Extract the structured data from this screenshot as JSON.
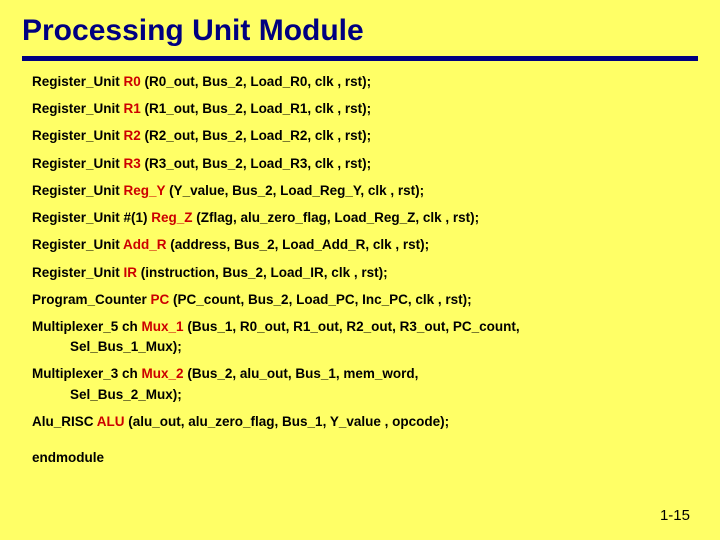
{
  "title": "Processing Unit Module",
  "lines": {
    "r0_a": "Register_Unit  ",
    "r0_b": "R0",
    "r0_c": " (R0_out, Bus_2, Load_R0, clk , rst);",
    "r1_a": "Register_Unit  ",
    "r1_b": "R1",
    "r1_c": " (R1_out, Bus_2, Load_R1, clk , rst);",
    "r2_a": "Register_Unit  ",
    "r2_b": "R2",
    "r2_c": " (R2_out, Bus_2, Load_R2, clk , rst);",
    "r3_a": "Register_Unit  ",
    "r3_b": "R3",
    "r3_c": " (R3_out, Bus_2, Load_R3, clk , rst);",
    "ry_a": "Register_Unit  ",
    "ry_b": "Reg_Y",
    "ry_c": " (Y_value, Bus_2, Load_Reg_Y, clk , rst);",
    "rz_a": "Register_Unit #(1)  ",
    "rz_b": "Reg_Z",
    "rz_c": "  (Zflag, alu_zero_flag, Load_Reg_Z, clk , rst);",
    "ar_a": "Register_Unit   ",
    "ar_b": "Add_R",
    "ar_c": " (address, Bus_2, Load_Add_R, clk , rst);",
    "ir_a": "Register_Unit   ",
    "ir_b": "IR",
    "ir_c": " (instruction, Bus_2, Load_IR, clk , rst);",
    "pc_a": "Program_Counter  ",
    "pc_b": "PC",
    "pc_c": " (PC_count, Bus_2, Load_PC,  Inc_PC, clk , rst);",
    "m1_a": "Multiplexer_5 ch ",
    "m1_b": "Mux_1",
    "m1_c": " (Bus_1, R0_out, R1_out, R2_out, R3_out, PC_count,",
    "m1_d": "Sel_Bus_1_Mux);",
    "m2_a": "Multiplexer_3 ch ",
    "m2_b": "Mux_2",
    "m2_c": " (Bus_2, alu_out, Bus_1, mem_word,",
    "m2_d": "Sel_Bus_2_Mux);",
    "alu_a": "Alu_RISC  ",
    "alu_b": "ALU",
    "alu_c": " (alu_out, alu_zero_flag, Bus_1, Y_value , opcode);",
    "end": "endmodule"
  },
  "footer": "1-15"
}
